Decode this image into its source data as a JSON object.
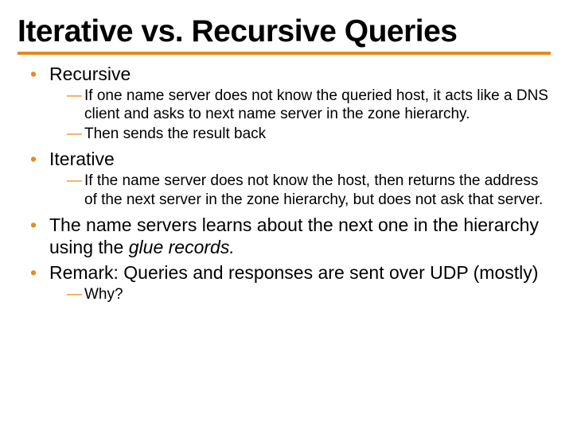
{
  "title": "Iterative vs. Recursive Queries",
  "bullets": {
    "b0": {
      "text": "Recursive"
    },
    "b0_sub": {
      "s0": "If one name server does not know the queried host, it acts like a DNS client and asks to next name server in the zone hierarchy.",
      "s1": "Then sends the result back"
    },
    "b1": {
      "text": "Iterative"
    },
    "b1_sub": {
      "s0": "If the name server does not know the host, then returns the address of the next server in the zone hierarchy, but does not ask that server."
    },
    "b2": {
      "pre": "The name servers learns about the next one in the hierarchy using the ",
      "em": "glue records.",
      "post": ""
    },
    "b3": {
      "text": "Remark: Queries and responses are sent over UDP (mostly)"
    },
    "b3_sub": {
      "s0": "Why?"
    }
  }
}
